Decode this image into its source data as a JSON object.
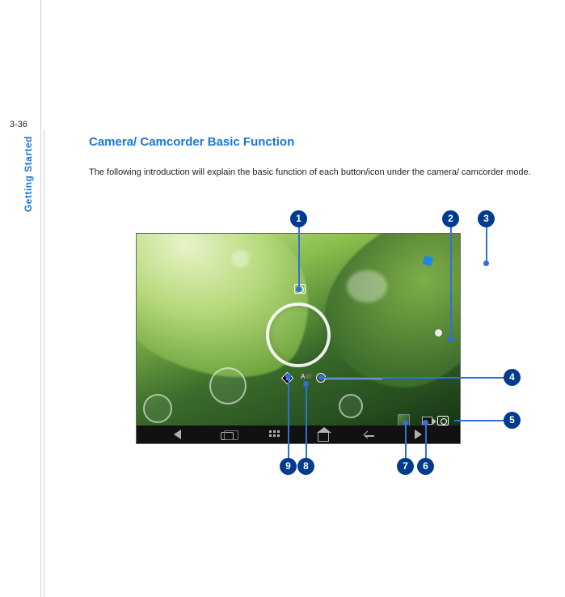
{
  "page_number": "3-36",
  "sidebar_label": "Getting Started",
  "heading": "Camera/ Camcorder Basic Function",
  "intro_text": "The following introduction will explain the basic function of each button/icon under the camera/ camcorder mode.",
  "callouts": {
    "c1": "1",
    "c2": "2",
    "c3": "3",
    "c4": "4",
    "c5": "5",
    "c6": "6",
    "c7": "7",
    "c8": "8",
    "c9": "9"
  }
}
